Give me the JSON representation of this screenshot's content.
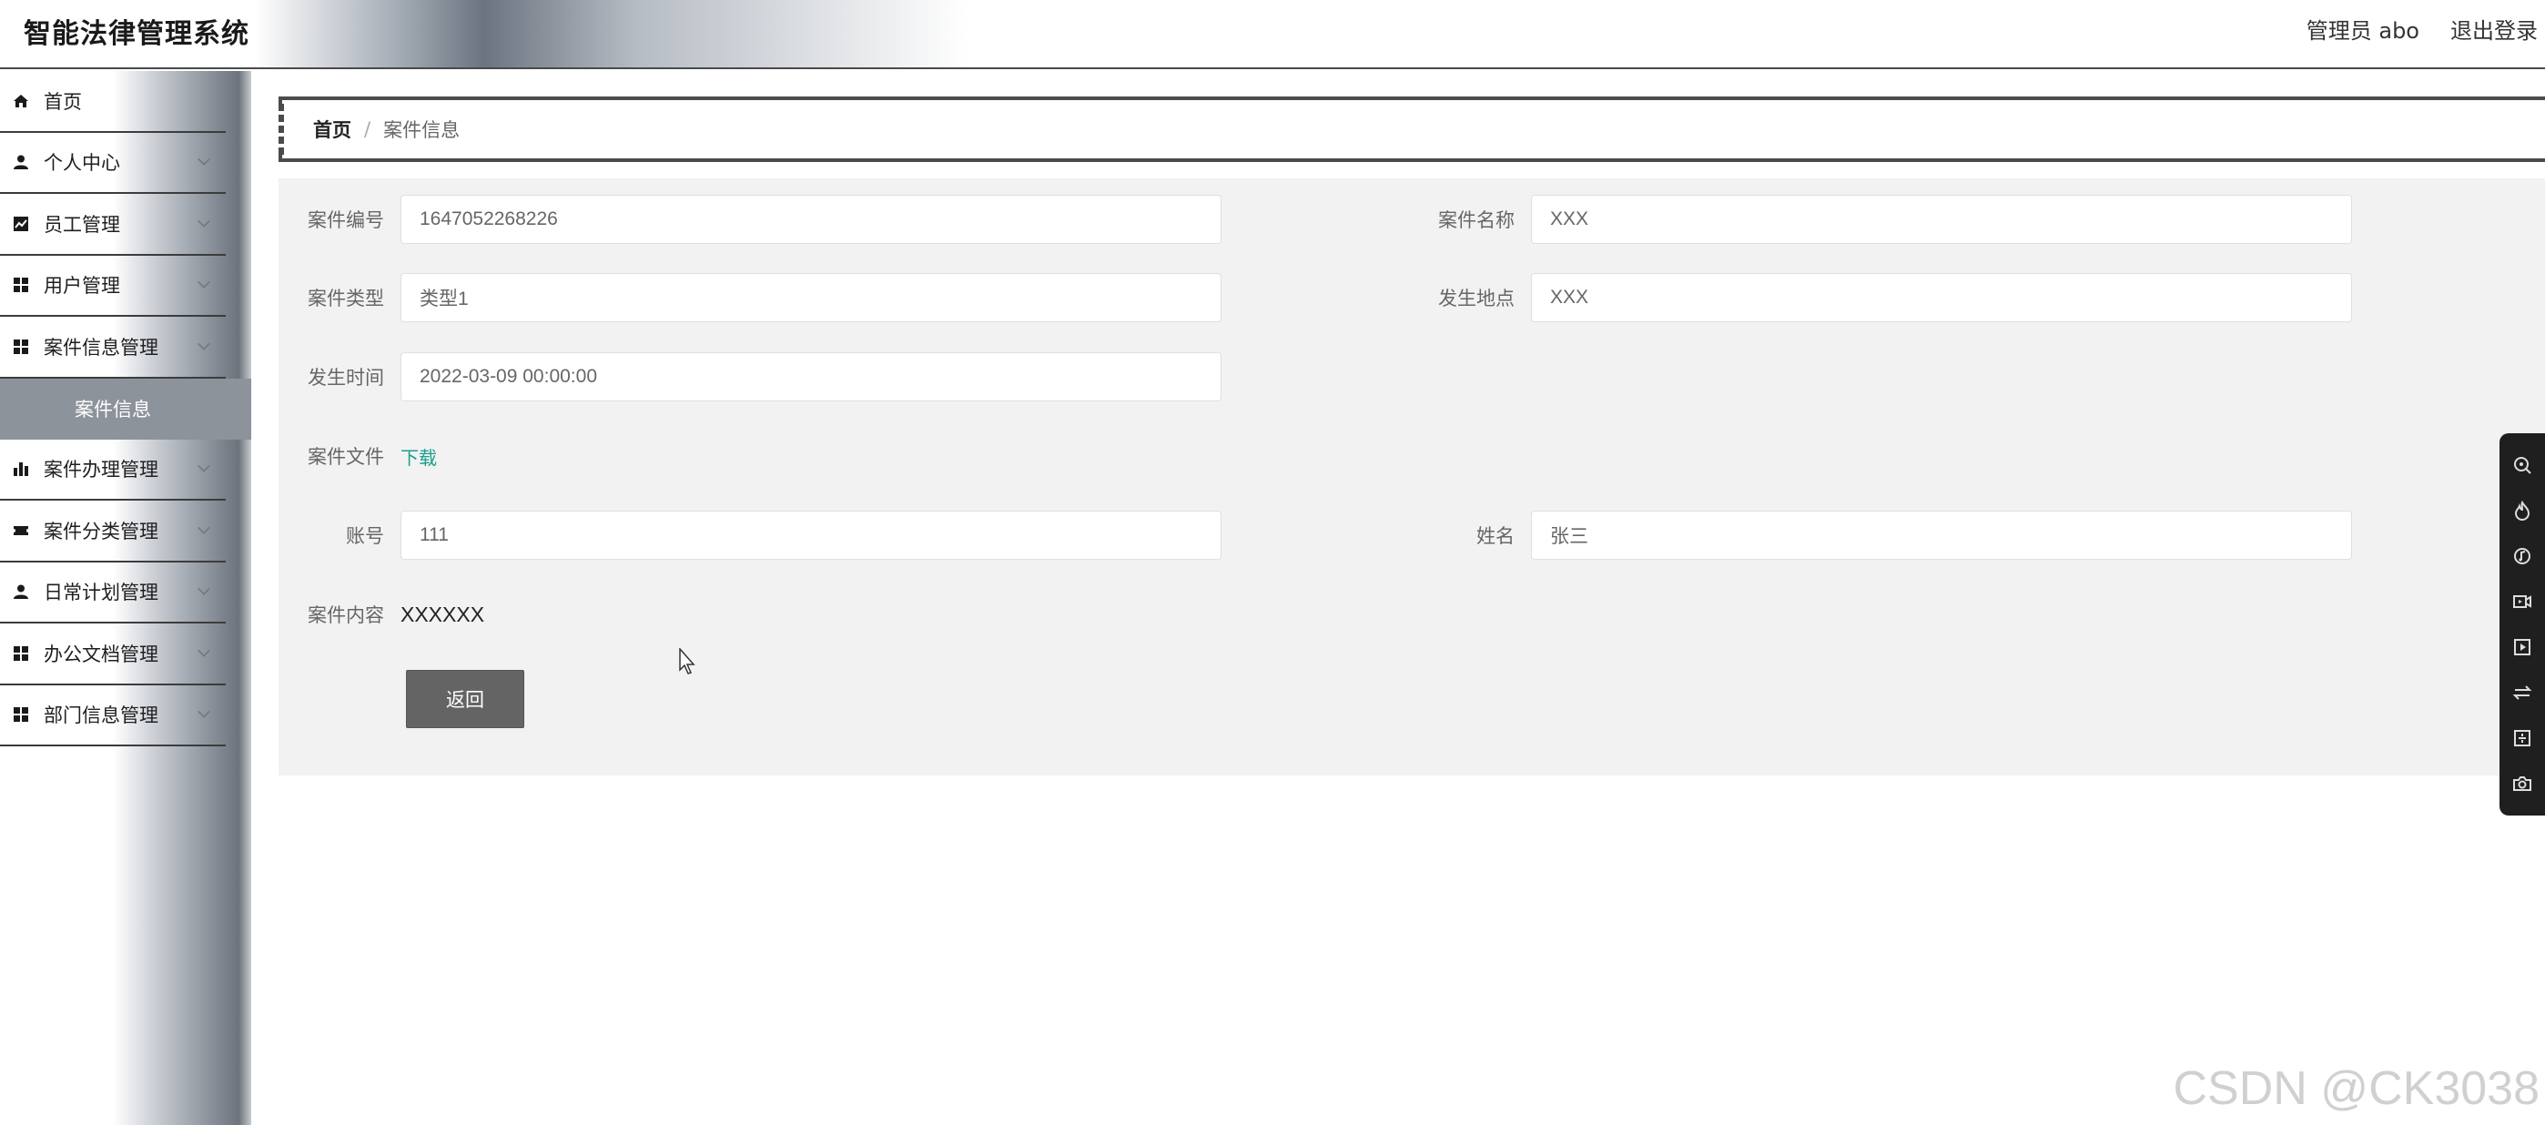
{
  "app": {
    "title": "智能法律管理系统",
    "user_label": "管理员 abo",
    "logout_label": "退出登录"
  },
  "sidebar": {
    "items": [
      {
        "label": "首页",
        "icon": "home-icon"
      },
      {
        "label": "个人中心",
        "icon": "user-icon"
      },
      {
        "label": "员工管理",
        "icon": "chart-icon"
      },
      {
        "label": "用户管理",
        "icon": "grid-icon"
      },
      {
        "label": "案件信息管理",
        "icon": "grid-icon"
      },
      {
        "label": "案件办理管理",
        "icon": "bar-chart-icon"
      },
      {
        "label": "案件分类管理",
        "icon": "ticket-icon"
      },
      {
        "label": "日常计划管理",
        "icon": "user-icon"
      },
      {
        "label": "办公文档管理",
        "icon": "grid-icon"
      },
      {
        "label": "部门信息管理",
        "icon": "grid-icon"
      }
    ],
    "active_sub": "案件信息"
  },
  "breadcrumb": {
    "home": "首页",
    "separator": "/",
    "current": "案件信息"
  },
  "form": {
    "case_no_label": "案件编号",
    "case_no_value": "1647052268226",
    "case_name_label": "案件名称",
    "case_name_value": "XXX",
    "case_type_label": "案件类型",
    "case_type_value": "类型1",
    "location_label": "发生地点",
    "location_value": "XXX",
    "time_label": "发生时间",
    "time_value": "2022-03-09 00:00:00",
    "file_label": "案件文件",
    "file_link": "下载",
    "account_label": "账号",
    "account_value": "111",
    "name_label": "姓名",
    "name_value": "张三",
    "content_label": "案件内容",
    "content_value": "XXXXXX",
    "back_button": "返回"
  },
  "watermark": "CSDN @CK3038",
  "colors": {
    "link": "#1aa08b",
    "active_sub_bg": "#8d939b",
    "button_bg": "#646464",
    "panel_bg": "#f2f2f2"
  }
}
